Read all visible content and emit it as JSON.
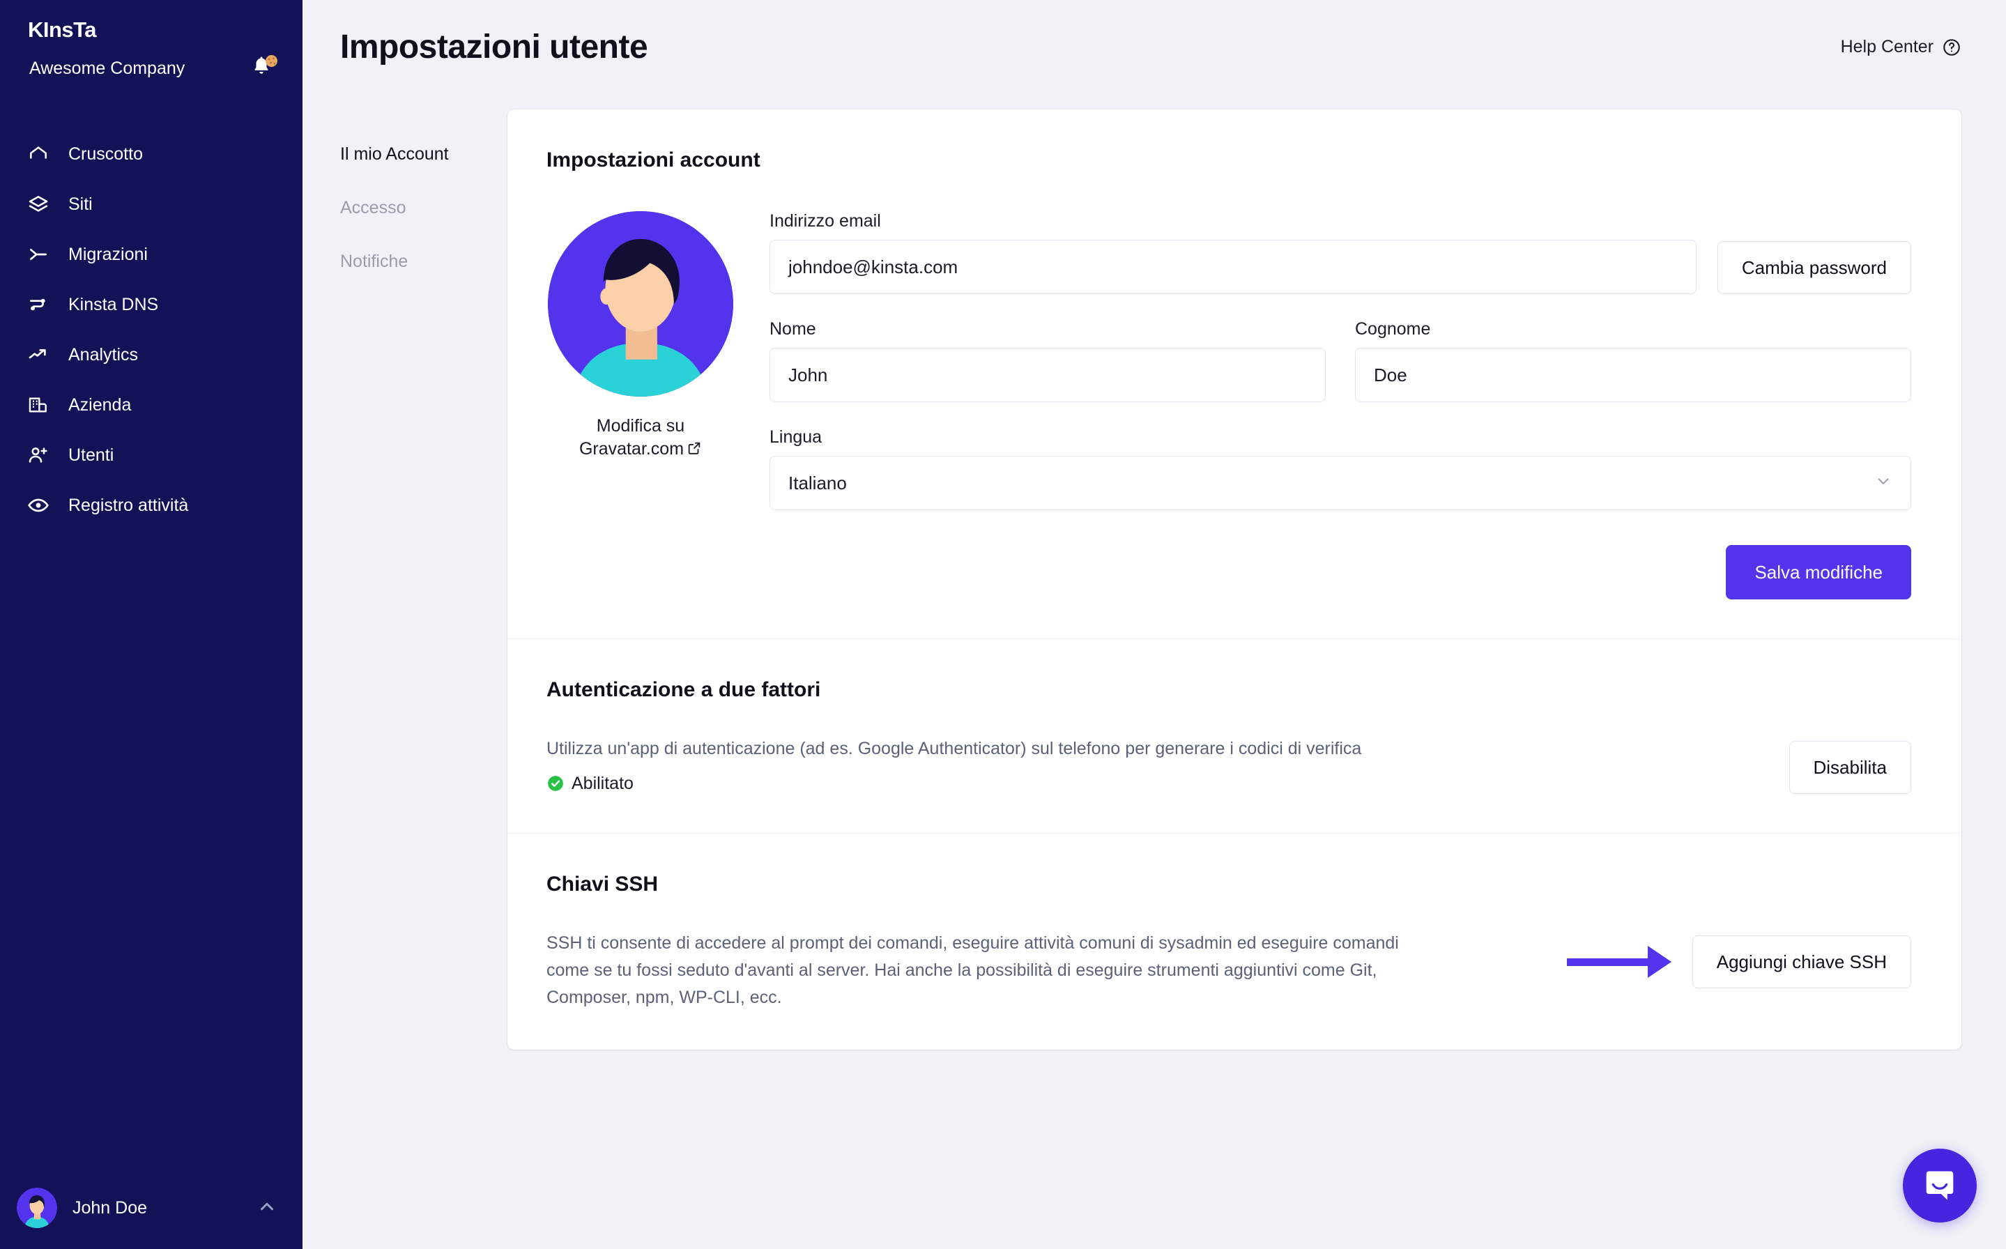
{
  "sidebar": {
    "logo": "Kinsta",
    "company": "Awesome Company",
    "bell_icon": "bell-icon",
    "items": [
      {
        "label": "Cruscotto",
        "icon": "home-icon"
      },
      {
        "label": "Siti",
        "icon": "layers-icon"
      },
      {
        "label": "Migrazioni",
        "icon": "migration-icon"
      },
      {
        "label": "Kinsta DNS",
        "icon": "dns-icon"
      },
      {
        "label": "Analytics",
        "icon": "trend-up-icon"
      },
      {
        "label": "Azienda",
        "icon": "building-icon"
      },
      {
        "label": "Utenti",
        "icon": "user-add-icon"
      },
      {
        "label": "Registro attività",
        "icon": "eye-icon"
      }
    ],
    "user": {
      "name": "John Doe",
      "chevron": "chevron-up-icon"
    }
  },
  "header": {
    "title": "Impostazioni utente",
    "help_center": "Help Center",
    "help_icon": "question-circle-icon"
  },
  "subnav": {
    "items": [
      {
        "label": "Il mio Account",
        "active": true
      },
      {
        "label": "Accesso",
        "active": false
      },
      {
        "label": "Notifiche",
        "active": false
      }
    ]
  },
  "account": {
    "title": "Impostazioni account",
    "gravatar_link_line1": "Modifica su",
    "gravatar_link_line2": "Gravatar.com",
    "external_link_icon": "external-link-icon",
    "email_label": "Indirizzo email",
    "email_value": "johndoe@kinsta.com",
    "email_placeholder": "Indirizzo email",
    "change_password_button": "Cambia password",
    "first_name_label": "Nome",
    "first_name_value": "John",
    "first_name_placeholder": "Nome",
    "last_name_label": "Cognome",
    "last_name_value": "Doe",
    "last_name_placeholder": "Cognome",
    "language_label": "Lingua",
    "language_value": "Italiano",
    "save_button": "Salva modifiche"
  },
  "two_factor": {
    "title": "Autenticazione a due fattori",
    "description": "Utilizza un'app di autenticazione (ad es. Google Authenticator) sul telefono per generare i codici di verifica",
    "status": "Abilitato",
    "status_icon": "check-circle-icon",
    "status_color": "#29c247",
    "disable_button": "Disabilita"
  },
  "ssh": {
    "title": "Chiavi SSH",
    "description": "SSH ti consente di accedere al prompt dei comandi, eseguire attività comuni di sysadmin ed eseguire comandi come se tu fossi seduto d'avanti al server. Hai anche la possibilità di eseguire strumenti aggiuntivi come Git, Composer, npm, WP-CLI, ecc.",
    "add_key_button": "Aggiungi chiave SSH",
    "annotation_arrow_color": "#5433ec"
  },
  "intercom": {
    "icon": "chat-bubble-icon",
    "color": "#4724e0"
  },
  "colors": {
    "sidebar_bg": "#131257",
    "page_bg": "#f1f2f7",
    "accent": "#5433ec",
    "card_bg": "#ffffff",
    "muted_text": "#5a6179"
  }
}
